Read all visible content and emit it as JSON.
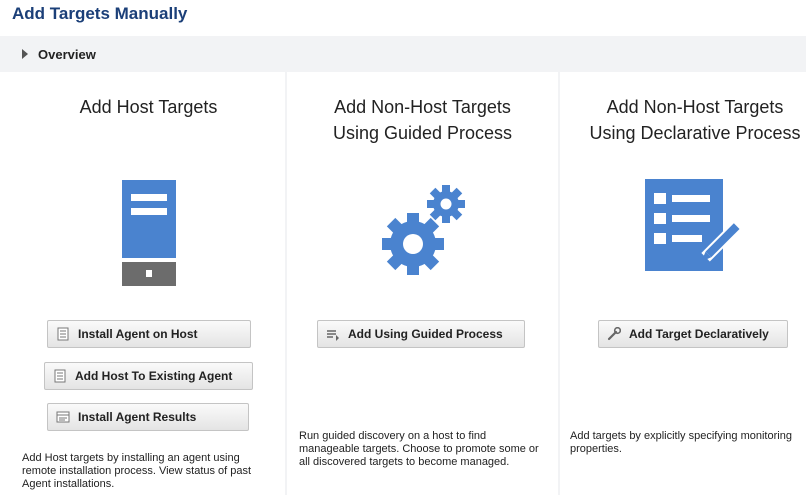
{
  "page": {
    "title": "Add Targets Manually"
  },
  "overview": {
    "label": "Overview"
  },
  "panels": [
    {
      "title_lines": [
        "Add Host Targets"
      ],
      "icon": "server-icon",
      "buttons": [
        {
          "label": "Install Agent on Host",
          "icon": "document-icon"
        },
        {
          "label": "Add Host To Existing Agent",
          "icon": "document-icon"
        },
        {
          "label": "Install Agent Results",
          "icon": "results-table-icon"
        }
      ],
      "description": "Add Host targets by installing an agent using remote installation process. View status of past Agent installations."
    },
    {
      "title_lines": [
        "Add Non-Host Targets",
        "Using Guided Process"
      ],
      "icon": "gears-icon",
      "buttons": [
        {
          "label": "Add Using Guided Process",
          "icon": "list-add-icon"
        }
      ],
      "description": "Run guided discovery on a host to find manageable targets. Choose to promote some or all discovered targets to become managed."
    },
    {
      "title_lines": [
        "Add Non-Host Targets",
        "Using Declarative Process"
      ],
      "icon": "form-edit-icon",
      "buttons": [
        {
          "label": "Add Target Declaratively",
          "icon": "wrench-icon"
        }
      ],
      "description": "Add targets by explicitly specifying monitoring properties."
    }
  ],
  "colors": {
    "accent": "#4a83cf",
    "title": "#1b3f78",
    "divider": "#f2f3f5"
  }
}
